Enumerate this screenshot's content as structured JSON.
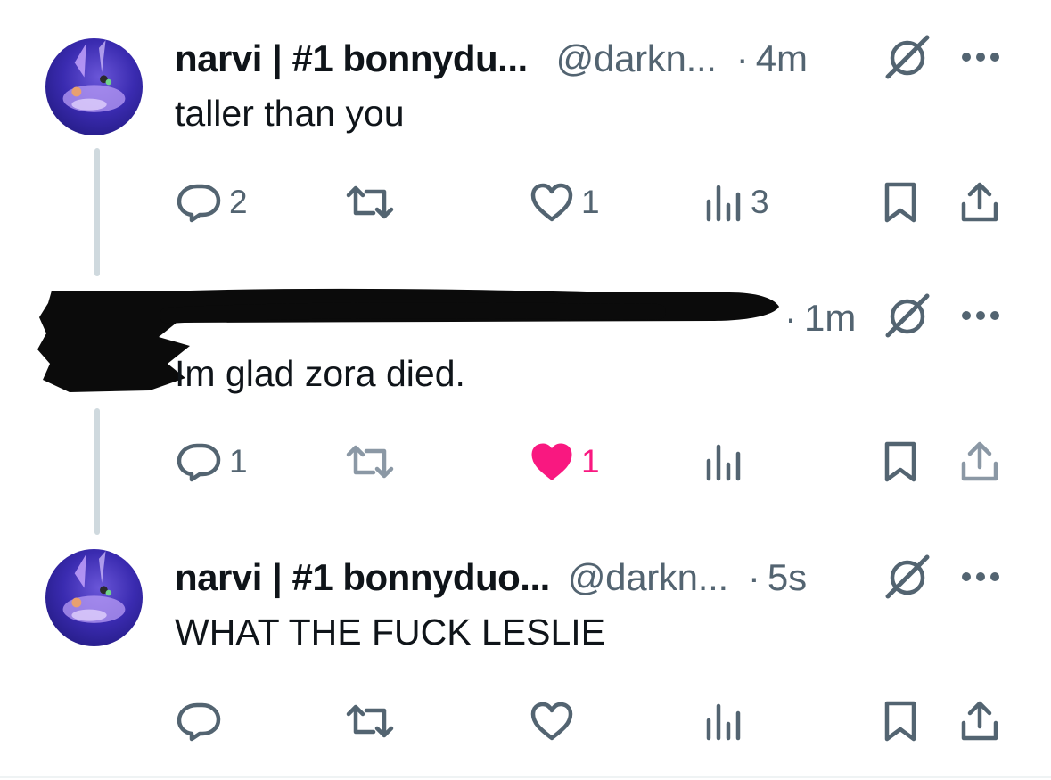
{
  "tweets": [
    {
      "display_name": "narvi | #1 bonnydu...",
      "handle": "@darkn...",
      "separator": "·",
      "time": "4m",
      "text": "taller than you",
      "icons": {
        "grok": "grok-icon",
        "more": "more-icon"
      },
      "actions": {
        "reply_count": "2",
        "retweet_count": "",
        "like_count": "1",
        "liked": false,
        "view_count": "3"
      }
    },
    {
      "display_name": "",
      "handle": "",
      "separator": "·",
      "time": "1m",
      "text": "Im glad zora died.",
      "redacted": true,
      "actions": {
        "reply_count": "1",
        "retweet_count": "",
        "like_count": "1",
        "liked": true,
        "view_count": ""
      }
    },
    {
      "display_name": "narvi | #1 bonnyduo...",
      "handle": "@darkn...",
      "separator": "·",
      "time": "5s",
      "text": "WHAT THE FUCK LESLIE",
      "actions": {
        "reply_count": "",
        "retweet_count": "",
        "like_count": "",
        "liked": false,
        "view_count": ""
      }
    }
  ],
  "colors": {
    "text": "#0f1419",
    "secondary": "#536471",
    "like_active": "#f91880",
    "thread_line": "#cfd9de"
  }
}
